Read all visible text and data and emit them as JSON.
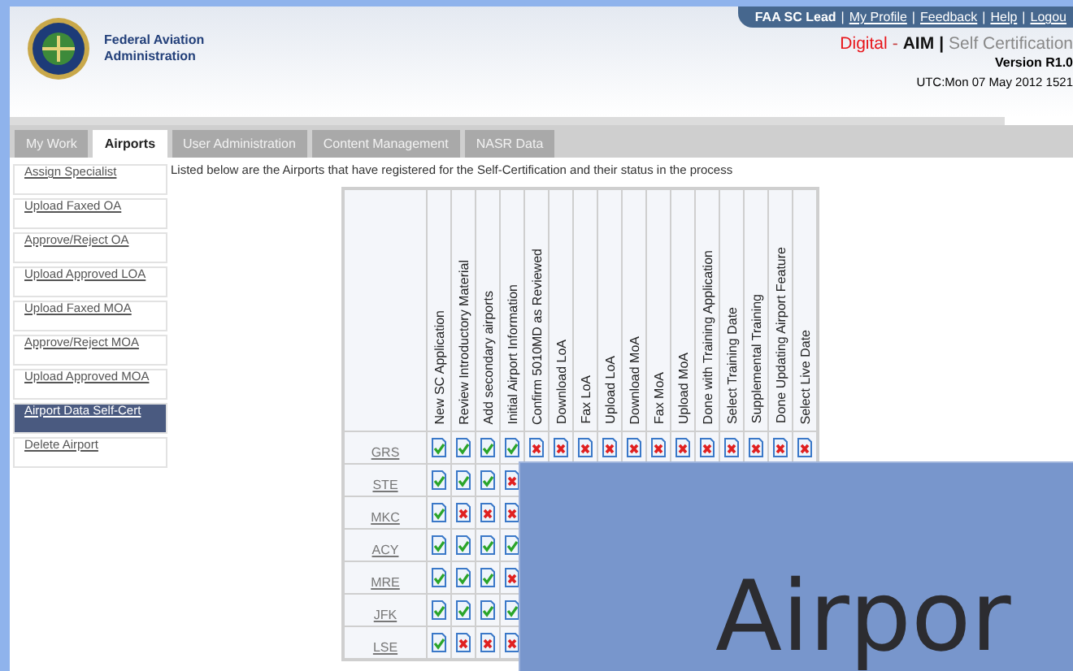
{
  "header": {
    "org_name": "Federal Aviation Administration",
    "user_links": [
      {
        "label": "FAA SC Lead",
        "kind": "user"
      },
      {
        "label": "My Profile",
        "kind": "link",
        "separator": "|"
      },
      {
        "label": "Feedback",
        "kind": "link",
        "separator": "|"
      },
      {
        "label": "Help",
        "kind": "link",
        "separator": "|"
      },
      {
        "label": "Logou",
        "kind": "link",
        "separator": "|"
      }
    ],
    "app_title": [
      {
        "text": "Digital",
        "kind": "brand"
      },
      {
        "text": "-",
        "kind": "sep"
      },
      {
        "text": "AIM",
        "kind": "product"
      },
      {
        "text": "|",
        "kind": "bar"
      },
      {
        "text": "Self Certification",
        "kind": "module"
      }
    ],
    "version": "Version R1.0",
    "timestamp": "UTC:Mon 07 May 2012 1521"
  },
  "tabs": [
    {
      "label": "My Work",
      "selected": false
    },
    {
      "label": "Airports",
      "selected": true
    },
    {
      "label": "User Administration",
      "selected": false
    },
    {
      "label": "Content Management",
      "selected": false
    },
    {
      "label": "NASR Data",
      "selected": false
    }
  ],
  "sidebar": {
    "items": [
      {
        "label": "Assign Specialist",
        "selected": false
      },
      {
        "label": "Upload Faxed OA",
        "selected": false
      },
      {
        "label": "Approve/Reject OA",
        "selected": false
      },
      {
        "label": "Upload Approved LOA",
        "selected": false
      },
      {
        "label": "Upload Faxed MOA",
        "selected": false
      },
      {
        "label": "Approve/Reject MOA",
        "selected": false
      },
      {
        "label": "Upload Approved MOA",
        "selected": false
      },
      {
        "label": "Airport Data Self-Cert",
        "selected": true
      },
      {
        "label": "Delete Airport",
        "selected": false
      }
    ]
  },
  "intro": "Listed below are the Airports that have registered for the Self-Certification and their status in the process",
  "table": {
    "columns": [
      "New SC Application",
      "Review Introductory Material",
      "Add secondary airports",
      "Initial Airport Information",
      "Confirm 5010MD as Reviewed",
      "Download LoA",
      "Fax LoA",
      "Upload LoA",
      "Download MoA",
      "Fax MoA",
      "Upload MoA",
      "Done with Training Application",
      "Select Training Date",
      "Supplemental Training",
      "Done Updating Airport Feature",
      "Select Live Date"
    ],
    "rows": [
      {
        "airport": "GRS",
        "steps": [
          true,
          true,
          true,
          true,
          false,
          false,
          false,
          false,
          false,
          false,
          false,
          false,
          false,
          false,
          false,
          false
        ]
      },
      {
        "airport": "STE",
        "steps": [
          true,
          true,
          true,
          false
        ]
      },
      {
        "airport": "MKC",
        "steps": [
          true,
          false,
          false,
          false
        ]
      },
      {
        "airport": "ACY",
        "steps": [
          true,
          true,
          true,
          true
        ]
      },
      {
        "airport": "MRE",
        "steps": [
          true,
          true,
          true,
          false
        ]
      },
      {
        "airport": "JFK",
        "steps": [
          true,
          true,
          true,
          true
        ]
      },
      {
        "airport": "LSE",
        "steps": [
          true,
          false,
          false,
          false
        ]
      }
    ]
  },
  "overlay": {
    "text": "Airpor"
  }
}
